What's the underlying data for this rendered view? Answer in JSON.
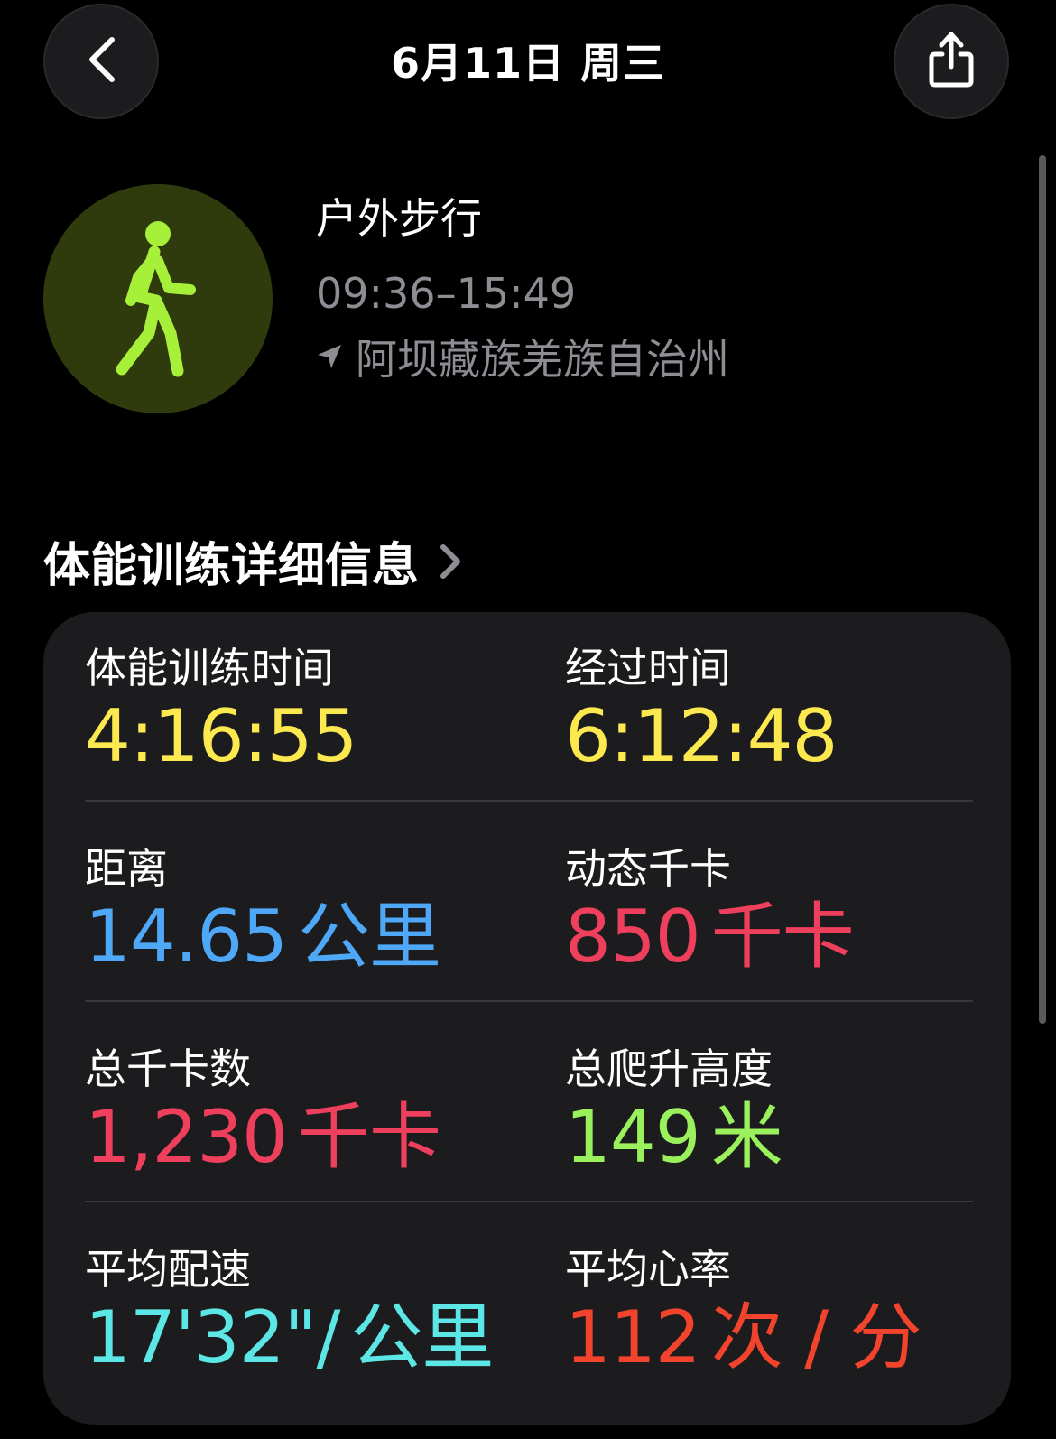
{
  "header": {
    "title": "6月11日 周三"
  },
  "workout": {
    "name": "户外步行",
    "time_range": "09:36–15:49",
    "location": "阿坝藏族羌族自治州"
  },
  "section": {
    "title": "体能训练详细信息"
  },
  "metrics": [
    {
      "label": "体能训练时间",
      "value": "4:16:55",
      "unit": "",
      "color": "#fce94f"
    },
    {
      "label": "经过时间",
      "value": "6:12:48",
      "unit": "",
      "color": "#fce94f"
    },
    {
      "label": "距离",
      "value": "14.65",
      "unit": "公里",
      "color": "#4fa8f7"
    },
    {
      "label": "动态千卡",
      "value": "850",
      "unit": "千卡",
      "color": "#ee3f5d"
    },
    {
      "label": "总千卡数",
      "value": "1,230",
      "unit": "千卡",
      "color": "#ee3f5d"
    },
    {
      "label": "总爬升高度",
      "value": "149",
      "unit": "米",
      "color": "#9af15c"
    },
    {
      "label": "平均配速",
      "value": "17'32\"/",
      "unit": "公里",
      "color": "#5de6e6"
    },
    {
      "label": "平均心率",
      "value": "112",
      "unit": "次 / 分",
      "color": "#f2442d"
    }
  ],
  "icons": {
    "back": "chevron-left-icon",
    "share": "share-icon",
    "activity": "walking-figure-icon",
    "location": "location-arrow-icon",
    "section_chevron": "chevron-right-icon"
  },
  "colors": {
    "activity_accent": "#a6f03a",
    "activity_bg": "#2f3a0d"
  }
}
